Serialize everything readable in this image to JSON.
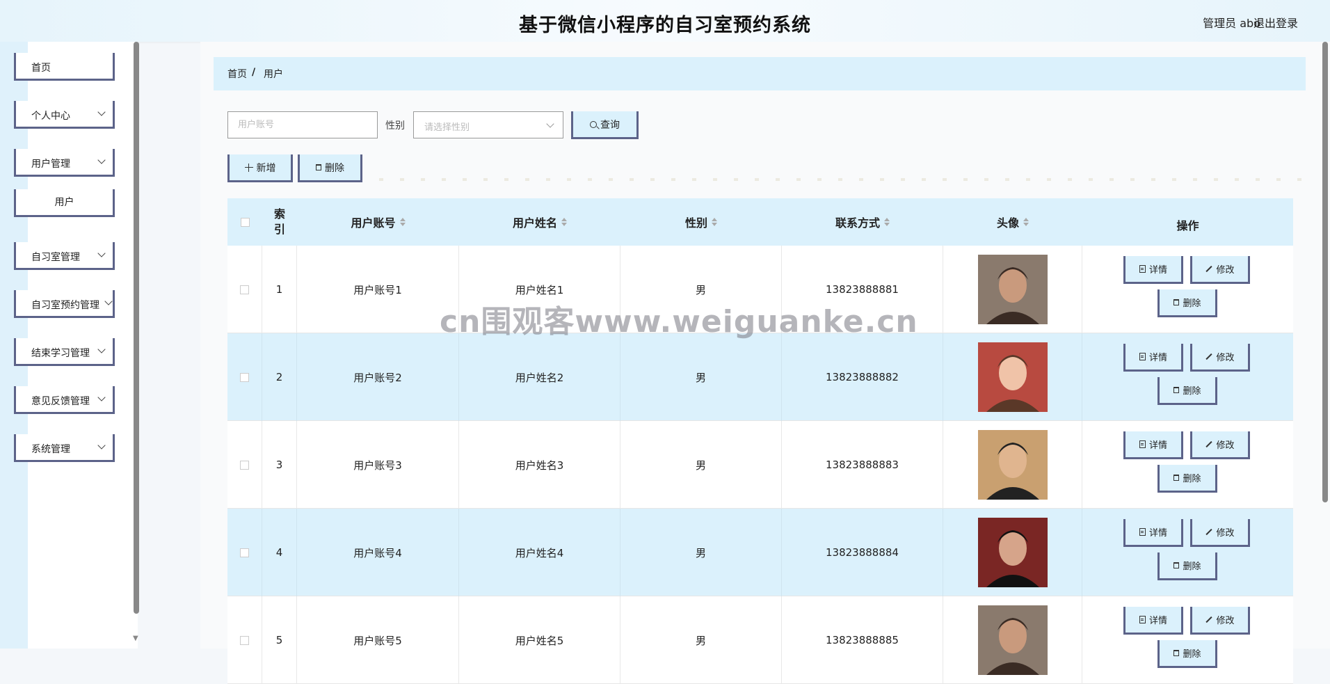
{
  "header": {
    "title": "基于微信小程序的自习室预约系统",
    "user": "管理员 abo",
    "logout": "退出登录"
  },
  "sidebar": {
    "items": [
      {
        "label": "首页"
      },
      {
        "label": "个人中心"
      },
      {
        "label": "用户管理"
      },
      {
        "label": "用户"
      },
      {
        "label": "自习室管理"
      },
      {
        "label": "自习室预约管理"
      },
      {
        "label": "结束学习管理"
      },
      {
        "label": "意见反馈管理"
      },
      {
        "label": "系统管理"
      }
    ]
  },
  "breadcrumb": {
    "home": "首页",
    "sep": "/",
    "current": "用户"
  },
  "search": {
    "account_placeholder": "用户账号",
    "gender_label": "性别",
    "gender_placeholder": "请选择性别",
    "query": "查询"
  },
  "actions": {
    "add": "新增",
    "delete": "删除"
  },
  "table": {
    "headers": {
      "index": "索\n引",
      "account": "用户账号",
      "name": "用户姓名",
      "gender": "性别",
      "phone": "联系方式",
      "avatar": "头像",
      "ops": "操作"
    },
    "op_labels": {
      "detail": "详情",
      "edit": "修改",
      "delete": "删除"
    },
    "rows": [
      {
        "index": "1",
        "account": "用户账号1",
        "name": "用户姓名1",
        "gender": "男",
        "phone": "13823888881"
      },
      {
        "index": "2",
        "account": "用户账号2",
        "name": "用户姓名2",
        "gender": "男",
        "phone": "13823888882"
      },
      {
        "index": "3",
        "account": "用户账号3",
        "name": "用户姓名3",
        "gender": "男",
        "phone": "13823888883"
      },
      {
        "index": "4",
        "account": "用户账号4",
        "name": "用户姓名4",
        "gender": "男",
        "phone": "13823888884"
      },
      {
        "index": "5",
        "account": "用户账号5",
        "name": "用户姓名5",
        "gender": "男",
        "phone": "13823888885"
      }
    ]
  },
  "watermark": "cn围观客www.weiguanke.cn",
  "colors": {
    "accent": "#dbf1fc",
    "border": "#5c6389"
  }
}
